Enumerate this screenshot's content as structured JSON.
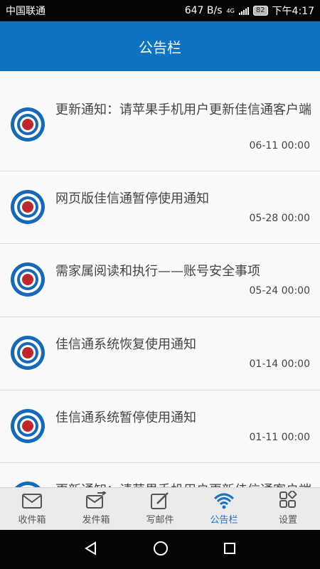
{
  "status_bar": {
    "carrier": "中国联通",
    "speed": "647 B/s",
    "network": "4G",
    "battery": "82",
    "time": "下午4:17"
  },
  "header": {
    "title": "公告栏"
  },
  "notices": [
    {
      "title": "更新通知：请苹果手机用户更新佳信通客户端",
      "date": "06-11 00:00"
    },
    {
      "title": "网页版佳信通暂停使用通知",
      "date": "05-28 00:00"
    },
    {
      "title": "需家属阅读和执行——账号安全事项",
      "date": "05-24 00:00"
    },
    {
      "title": "佳信通系统恢复使用通知",
      "date": "01-14 00:00"
    },
    {
      "title": "佳信通系统暂停使用通知",
      "date": "01-11 00:00"
    },
    {
      "title": "更新通知：请苹果手机用户更新佳信通客户端",
      "date": ""
    }
  ],
  "tabs": [
    {
      "label": "收件箱",
      "icon": "inbox-icon"
    },
    {
      "label": "发件箱",
      "icon": "outbox-icon"
    },
    {
      "label": "写邮件",
      "icon": "compose-icon"
    },
    {
      "label": "公告栏",
      "icon": "wifi-icon",
      "active": true
    },
    {
      "label": "设置",
      "icon": "settings-grid-icon"
    }
  ],
  "colors": {
    "header": "#0b73c2",
    "active_tab": "#1b73c5",
    "target_red": "#c0272d"
  }
}
